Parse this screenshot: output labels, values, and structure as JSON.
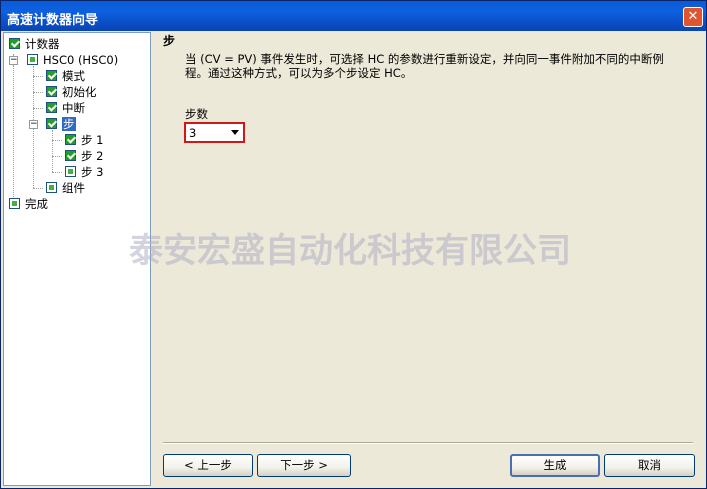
{
  "window": {
    "title": "高速计数器向导",
    "close_symbol": "✕"
  },
  "tree": {
    "root": "计数器",
    "hsc": "HSC0 (HSC0)",
    "mode": "模式",
    "init": "初始化",
    "interrupt": "中断",
    "step": "步",
    "step1": "步 1",
    "step2": "步 2",
    "step3": "步 3",
    "component": "组件",
    "finish": "完成",
    "expander_minus": "−"
  },
  "main": {
    "heading": "步",
    "description": "当 (CV = PV) 事件发生时，可选择 HC 的参数进行重新设定，并向同一事件附加不同的中断例程。通过这种方式，可以为多个步设定 HC。",
    "steps_label": "步数",
    "steps_value": "3"
  },
  "watermark": "泰安宏盛自动化科技有限公司",
  "buttons": {
    "prev": "< 上一步",
    "next": "下一步 >",
    "generate": "生成",
    "cancel": "取消"
  },
  "colors": {
    "title_bar": "#0a5bd6",
    "check_green": "#21a121",
    "highlight_red": "#d01818",
    "selection": "#316ac5"
  }
}
